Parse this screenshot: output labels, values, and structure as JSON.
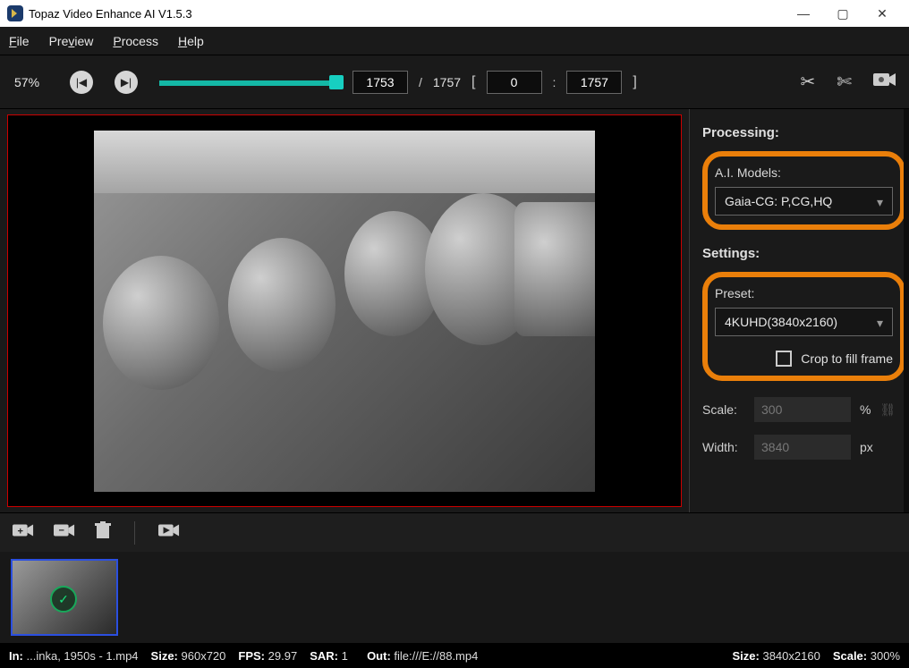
{
  "title": "Topaz Video Enhance AI V1.5.3",
  "menubar": {
    "file": "File",
    "preview": "Preview",
    "process": "Process",
    "help": "Help"
  },
  "toolbar": {
    "zoom_pct": "57%",
    "frame_current": "1753",
    "frame_total": "1757",
    "range_start": "0",
    "range_end": "1757"
  },
  "sidepanel": {
    "processing_label": "Processing:",
    "ai_models_label": "A.I. Models:",
    "ai_model_selected": "Gaia-CG: P,CG,HQ",
    "settings_label": "Settings:",
    "preset_label": "Preset:",
    "preset_selected": "4KUHD(3840x2160)",
    "crop_label": "Crop to fill frame",
    "scale_label": "Scale:",
    "scale_value": "300",
    "scale_unit": "%",
    "width_label": "Width:",
    "width_value": "3840",
    "width_unit": "px"
  },
  "status": {
    "in_label": "In:",
    "in_value": "...inka, 1950s - 1.mp4",
    "size_in_label": "Size:",
    "size_in_value": "960x720",
    "fps_label": "FPS:",
    "fps_value": "29.97",
    "sar_label": "SAR:",
    "sar_value": "1",
    "out_label": "Out:",
    "out_value": "file:///E://88.mp4",
    "size_out_label": "Size:",
    "size_out_value": "3840x2160",
    "scale_label": "Scale:",
    "scale_value": "300%"
  }
}
